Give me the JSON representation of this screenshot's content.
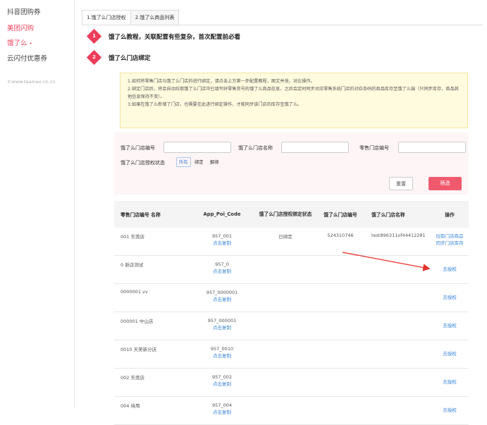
{
  "sidebar": {
    "items": [
      {
        "label": "抖音团购券"
      },
      {
        "label": "美团闪购"
      },
      {
        "label": "饿了么",
        "dot": "•"
      },
      {
        "label": "云闪付优惠券"
      }
    ],
    "watermark": "©www.teamax-cn.cn"
  },
  "tabs": [
    {
      "label": "1.饿了么门店授权"
    },
    {
      "label": "2.饿了么商品列表"
    }
  ],
  "steps": [
    {
      "num": "1",
      "title": "饿了么教程，关联配置有些复杂，首次配置前必看"
    },
    {
      "num": "2",
      "title": "饿了么门店绑定"
    }
  ],
  "notice": [
    "1.如何将零售门店与饿了么门店的进行绑定，请点击上方第一步配置教程，图文并茂，对比操作。",
    "2.绑定门店后，将会自动拉取饿了么门店中已填写好零售货号的饿了么商品信息，之后会定时同步对应零售系统门店的对应条码的商品库存至饿了么端（只同步库存，商品其他信息保持不变）。",
    "3.如果在饿了么新增了门店，也需要在此进行绑定操作，才能同步该门店的库存至饿了么。"
  ],
  "filter": {
    "eleme_code_label": "饿了么门店编号",
    "eleme_name_label": "饿了么门店名称",
    "retail_code_label": "零售门店编号",
    "auth_status_label": "饿了么门店授权状态",
    "status_options": [
      "所有",
      "绑定",
      "解绑"
    ],
    "reset": "重置",
    "submit": "筛选"
  },
  "table": {
    "headers": [
      "零售门店编号 名称",
      "App_Poi_Code",
      "饿了么门店授权绑定状态",
      "饿了么门店编号",
      "饿了么门店名称",
      "操作"
    ],
    "copy_label": "点击复制",
    "rows": [
      {
        "retail": "001  东莞店",
        "code": "957_001",
        "status": "已绑定",
        "eleme_id": "524310746",
        "eleme_name": "test896311of44412281",
        "actions": [
          "拉取门店商品",
          "同步门店库存"
        ]
      },
      {
        "retail": "0  新店测试",
        "code": "957_0",
        "status": "",
        "eleme_id": "",
        "eleme_name": "",
        "actions": [
          "去授权"
        ]
      },
      {
        "retail": "0000001  vv",
        "code": "957_0000001",
        "status": "",
        "eleme_id": "",
        "eleme_name": "",
        "actions": [
          "去授权"
        ]
      },
      {
        "retail": "000001  中山店",
        "code": "957_000001",
        "status": "",
        "eleme_id": "",
        "eleme_name": "",
        "actions": [
          "去授权"
        ]
      },
      {
        "retail": "0010  天美新分店",
        "code": "957_0010",
        "status": "",
        "eleme_id": "",
        "eleme_name": "",
        "actions": [
          "去授权"
        ]
      },
      {
        "retail": "002  东莞店",
        "code": "957_002",
        "status": "",
        "eleme_id": "",
        "eleme_name": "",
        "actions": [
          "去授权"
        ]
      },
      {
        "retail": "004  待用",
        "code": "957_004",
        "status": "",
        "eleme_id": "",
        "eleme_name": "",
        "actions": [
          "去授权"
        ]
      }
    ]
  },
  "colors": {
    "accent": "#ee3c5b",
    "link": "#3a86d9",
    "notice_bg": "#fffbdf",
    "filter_bg": "#fdf5f6"
  }
}
